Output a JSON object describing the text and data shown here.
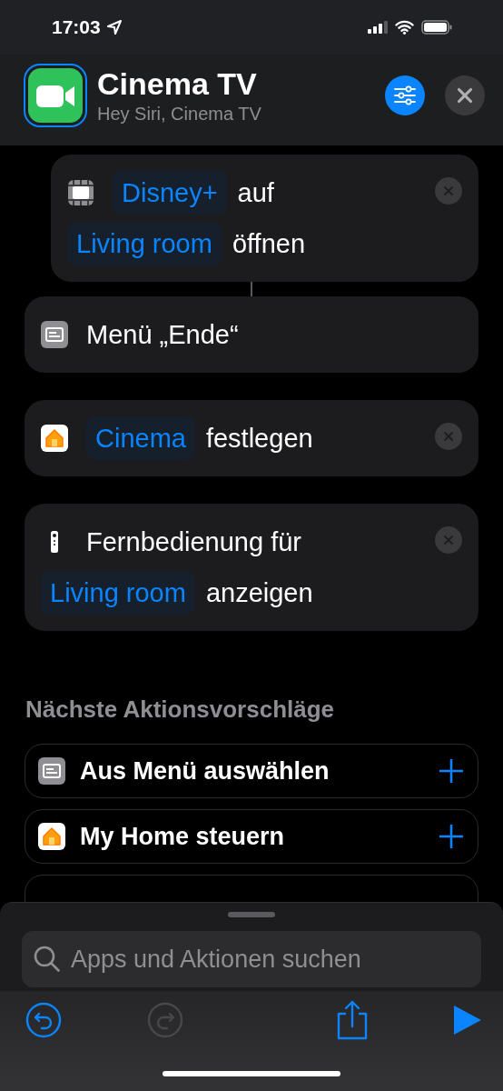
{
  "status_bar": {
    "time": "17:03"
  },
  "header": {
    "title": "Cinema TV",
    "subtitle": "Hey Siri, Cinema TV"
  },
  "actions": [
    {
      "kind": "open-app",
      "indented": true,
      "removable": true,
      "parts": [
        {
          "kind": "token",
          "text": "Disney+"
        },
        {
          "kind": "text",
          "text": "auf"
        },
        {
          "kind": "token",
          "text": "Living room"
        },
        {
          "kind": "text",
          "text": "öffnen"
        }
      ]
    },
    {
      "kind": "menu",
      "indented": false,
      "removable": false,
      "parts": [
        {
          "kind": "text",
          "text": "Menü „Ende“"
        }
      ]
    },
    {
      "kind": "home",
      "indented": false,
      "removable": true,
      "parts": [
        {
          "kind": "token",
          "text": "Cinema"
        },
        {
          "kind": "text",
          "text": "festlegen"
        }
      ]
    },
    {
      "kind": "remote",
      "indented": false,
      "removable": true,
      "parts": [
        {
          "kind": "text",
          "text": "Fernbedienung für"
        },
        {
          "kind": "token",
          "text": "Living room"
        },
        {
          "kind": "text",
          "text": "anzeigen"
        }
      ]
    }
  ],
  "suggestions": {
    "title": "Nächste Aktionsvorschläge",
    "items": [
      {
        "kind": "menu",
        "label": "Aus Menü auswählen"
      },
      {
        "kind": "home",
        "label": "My Home steuern"
      }
    ]
  },
  "search": {
    "placeholder": "Apps und Aktionen suchen"
  },
  "toolbar": [
    {
      "kind": "undo",
      "disabled": false
    },
    {
      "kind": "redo",
      "disabled": true
    },
    {
      "kind": "share",
      "disabled": false
    },
    {
      "kind": "run",
      "disabled": false
    }
  ]
}
